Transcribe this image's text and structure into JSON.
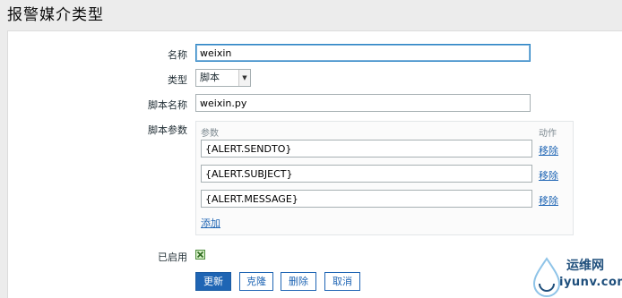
{
  "page": {
    "title": "报警媒介类型"
  },
  "form": {
    "name_label": "名称",
    "name_value": "weixin",
    "type_label": "类型",
    "type_selected": "脚本",
    "script_name_label": "脚本名称",
    "script_name_value": "weixin.py",
    "script_params_label": "脚本参数",
    "params_header": "参数",
    "action_header": "动作",
    "params": [
      {
        "value": "{ALERT.SENDTO}",
        "remove_label": "移除"
      },
      {
        "value": "{ALERT.SUBJECT}",
        "remove_label": "移除"
      },
      {
        "value": "{ALERT.MESSAGE}",
        "remove_label": "移除"
      }
    ],
    "add_label": "添加",
    "enabled_label": "已启用",
    "enabled": true
  },
  "buttons": {
    "update": "更新",
    "clone": "克隆",
    "delete": "删除",
    "cancel": "取消"
  },
  "watermark": {
    "title": "运维网",
    "url": "iyunv.com"
  },
  "colors": {
    "accent": "#1f65b4",
    "page_bg": "#ececec",
    "checkbox_green": "#4c8c3c"
  }
}
